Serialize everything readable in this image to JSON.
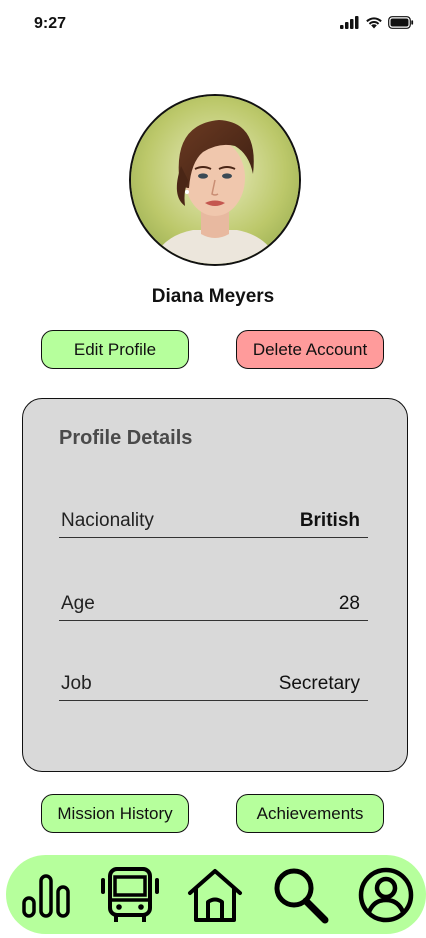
{
  "status_bar": {
    "time": "9:27",
    "icons": [
      "signal-icon",
      "wifi-icon",
      "battery-icon"
    ]
  },
  "profile": {
    "avatar_icon": "profile-photo",
    "name": "Diana Meyers"
  },
  "actions": {
    "edit_label": "Edit Profile",
    "delete_label": "Delete Account"
  },
  "details": {
    "title": "Profile Details",
    "rows": [
      {
        "label": "Nacionality",
        "value": "British"
      },
      {
        "label": "Age",
        "value": "28"
      },
      {
        "label": "Job",
        "value": "Secretary"
      }
    ]
  },
  "links": {
    "mission_history_label": "Mission History",
    "achievements_label": "Achievements"
  },
  "bottom_nav": {
    "items": [
      "stats-icon",
      "bus-icon",
      "home-icon",
      "search-icon",
      "account-icon"
    ]
  },
  "colors": {
    "accent_green": "#b6ff9c",
    "danger_red": "#ff9b9b",
    "card_gray": "#d9d9d9"
  }
}
